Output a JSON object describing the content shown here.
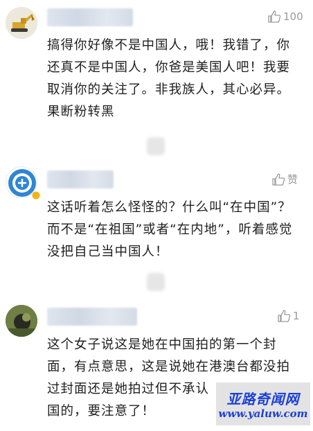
{
  "comments": [
    {
      "likes_label": "100",
      "lines": [
        "搞得你好像不是中国人，哦！我错了，你",
        "还真不是中国人，你爸是美国人吧！我要",
        "取消你的关注了。非我族人，其心必异。",
        "果断粉转黑"
      ]
    },
    {
      "likes_label": "赞",
      "lines": [
        "这话听着怎么怪怪的？什么叫“在中国”？",
        "而不是“在祖国”或者“在内地”，听着感觉",
        "没把自己当中国人！"
      ]
    },
    {
      "likes_label": "1",
      "lines": [
        "这个女子说这是她在中国拍的第一个封",
        "面，有点意思，这是说她在港澳台都没拍",
        "过封面还是她拍过但不承认",
        "国的，要注意了！"
      ]
    }
  ],
  "watermark": {
    "title": "亚路奇闻网",
    "url": "www.yaluw.com"
  },
  "colors": {
    "text": "#1f1f1f",
    "like_gray": "#9a9a9a",
    "watermark_blue": "#1c3fd8"
  }
}
